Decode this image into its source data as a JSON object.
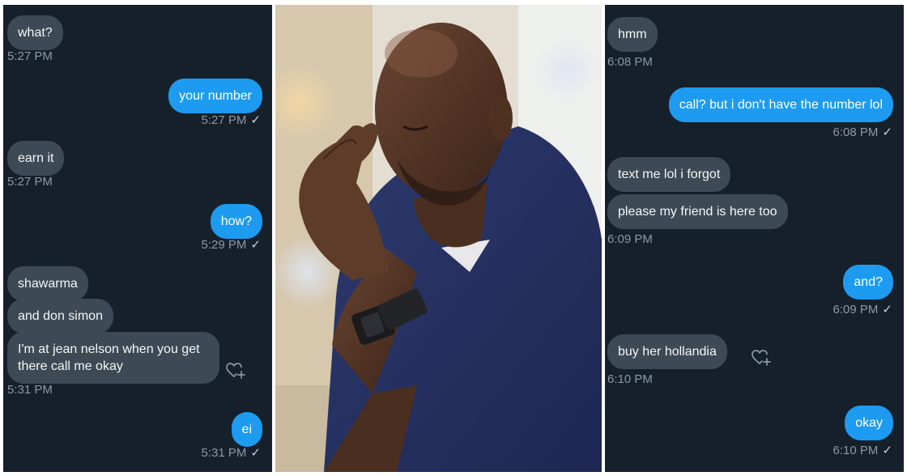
{
  "left": {
    "messages": [
      {
        "text": "what?",
        "time": "5:27 PM"
      },
      {
        "text": "your number",
        "time": "5:27 PM",
        "check": "✓"
      },
      {
        "text": "earn it",
        "time": "5:27 PM"
      },
      {
        "text": "how?",
        "time": "5:29 PM",
        "check": "✓"
      },
      {
        "text": "shawarma"
      },
      {
        "text": "and don simon"
      },
      {
        "text": "I'm at jean nelson when you get there call me okay",
        "time": "5:31 PM"
      },
      {
        "text": "ei",
        "time": "5:31 PM",
        "check": "✓"
      }
    ]
  },
  "right": {
    "messages": [
      {
        "text": "hmm",
        "time": "6:08 PM"
      },
      {
        "text": "call? but i don't have the number lol",
        "time": "6:08 PM",
        "check": "✓"
      },
      {
        "text": "text me lol i forgot"
      },
      {
        "text": "please my friend is here too",
        "time": "6:09 PM"
      },
      {
        "text": "and?",
        "time": "6:09 PM",
        "check": "✓"
      },
      {
        "text": "buy her hollandia",
        "time": "6:10 PM"
      },
      {
        "text": "okay",
        "time": "6:10 PM",
        "check": "✓"
      }
    ]
  },
  "icons": {
    "react": "heart-plus-icon",
    "sent": "checkmark-icon"
  },
  "colors": {
    "background": "#15202b",
    "incoming_bubble": "#3d4954",
    "outgoing_bubble": "#1d9bf0",
    "timestamp": "#8b98a5"
  }
}
